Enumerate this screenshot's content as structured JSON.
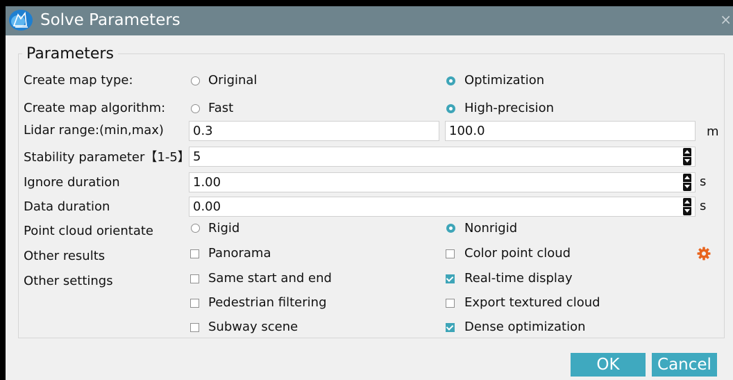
{
  "window": {
    "title": "Solve Parameters",
    "close_glyph": "×",
    "app_icon": "lidar-app-icon"
  },
  "group": {
    "legend": "Parameters"
  },
  "rows": {
    "map_type": {
      "label": "Create map type:",
      "options": [
        "Original",
        "Optimization"
      ],
      "selected": "Optimization"
    },
    "map_algorithm": {
      "label": "Create map algorithm:",
      "options": [
        "Fast",
        "High-precision"
      ],
      "selected": "High-precision"
    },
    "lidar_range": {
      "label": "Lidar range:(min,max)",
      "min": "0.3",
      "max": "100.0",
      "unit": "m"
    },
    "stability": {
      "label": "Stability parameter【1-5】",
      "value": "5"
    },
    "ignore_duration": {
      "label": "Ignore duration",
      "value": "1.00",
      "unit": "s"
    },
    "data_duration": {
      "label": "Data duration",
      "value": "0.00",
      "unit": "s"
    },
    "orientation": {
      "label": "Point cloud orientate",
      "options": [
        "Rigid",
        "Nonrigid"
      ],
      "selected": "Nonrigid"
    },
    "other_results": {
      "label": "Other results",
      "options": [
        {
          "label": "Panorama",
          "checked": false
        },
        {
          "label": "Color point cloud",
          "checked": false
        }
      ],
      "settings_icon": "gear-icon"
    },
    "other_settings": {
      "label": "Other settings",
      "options": [
        {
          "label": "Same start and end",
          "checked": false
        },
        {
          "label": "Real-time display",
          "checked": true
        },
        {
          "label": "Pedestrian filtering",
          "checked": false
        },
        {
          "label": "Export textured cloud",
          "checked": false
        },
        {
          "label": "Subway scene",
          "checked": false
        },
        {
          "label": "Dense optimization",
          "checked": true
        }
      ]
    }
  },
  "buttons": {
    "ok": "OK",
    "cancel": "Cancel"
  },
  "colors": {
    "accent": "#3fa9bf",
    "titlebar": "#6e848d",
    "gear": "#e8641e"
  }
}
